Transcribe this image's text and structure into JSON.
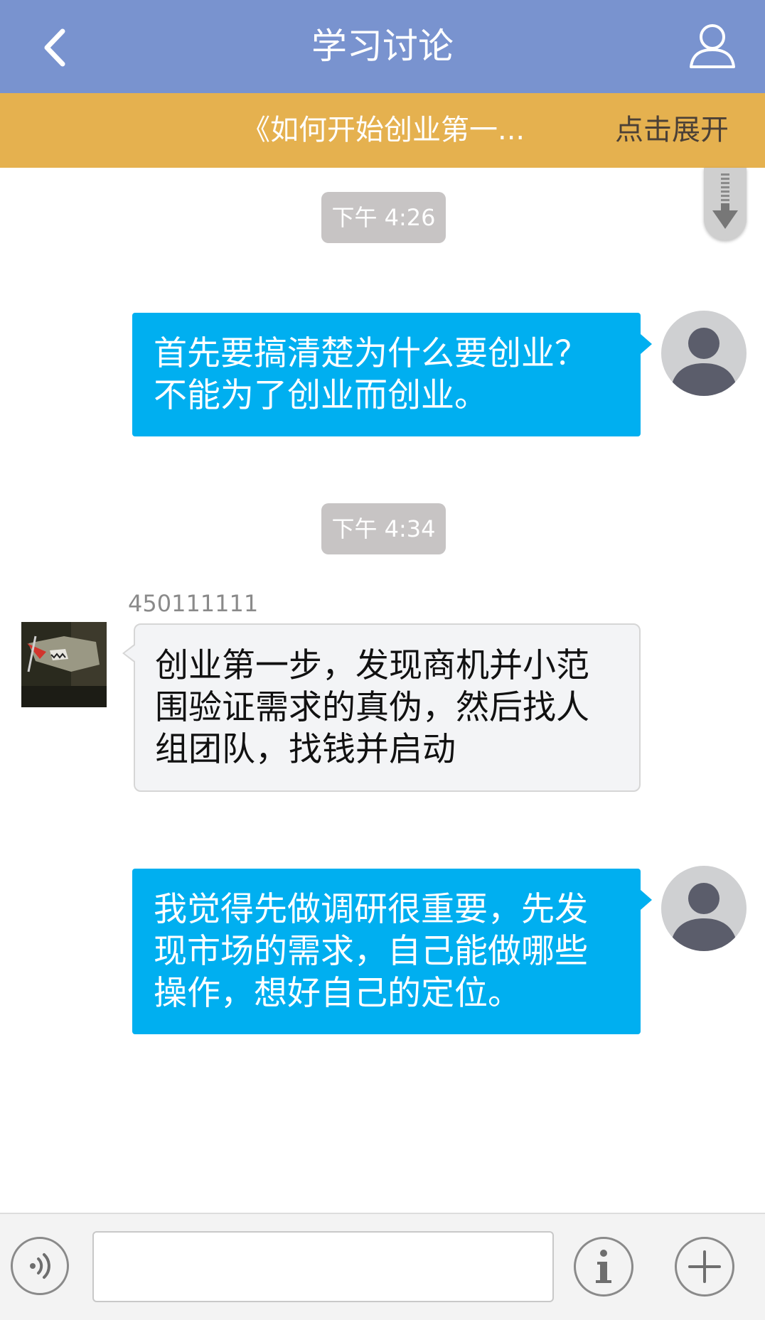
{
  "header": {
    "title": "学习讨论",
    "back_icon": "chevron-left-icon",
    "user_icon": "user-outline-icon",
    "background": "#7993cf"
  },
  "topic_bar": {
    "title": "《如何开始创业第一...",
    "expand_label": "点击展开",
    "background": "#e5b14f"
  },
  "messages": [
    {
      "type": "time",
      "text": "下午 4:26"
    },
    {
      "type": "outgoing",
      "lines": [
        "首先要搞清楚为什么要创业？",
        "不能为了创业而创业。"
      ]
    },
    {
      "type": "time",
      "text": "下午 4:34"
    },
    {
      "type": "incoming",
      "sender": "450111111",
      "lines": [
        "创业第一步，发现商机并小范",
        "围验证需求的真伪，然后找人",
        "组团队，找钱并启动"
      ]
    },
    {
      "type": "outgoing",
      "lines": [
        "我觉得先做调研很重要，先发",
        "现市场的需求，自己能做哪些",
        "操作，想好自己的定位。"
      ]
    }
  ],
  "input": {
    "value": "",
    "placeholder": ""
  },
  "bottom_icons": [
    "voice-icon",
    "info-icon",
    "plus-icon"
  ],
  "colors": {
    "outgoing_bubble": "#00aff0",
    "incoming_bubble": "#f3f4f6",
    "time_pill": "#c7c4c4"
  }
}
